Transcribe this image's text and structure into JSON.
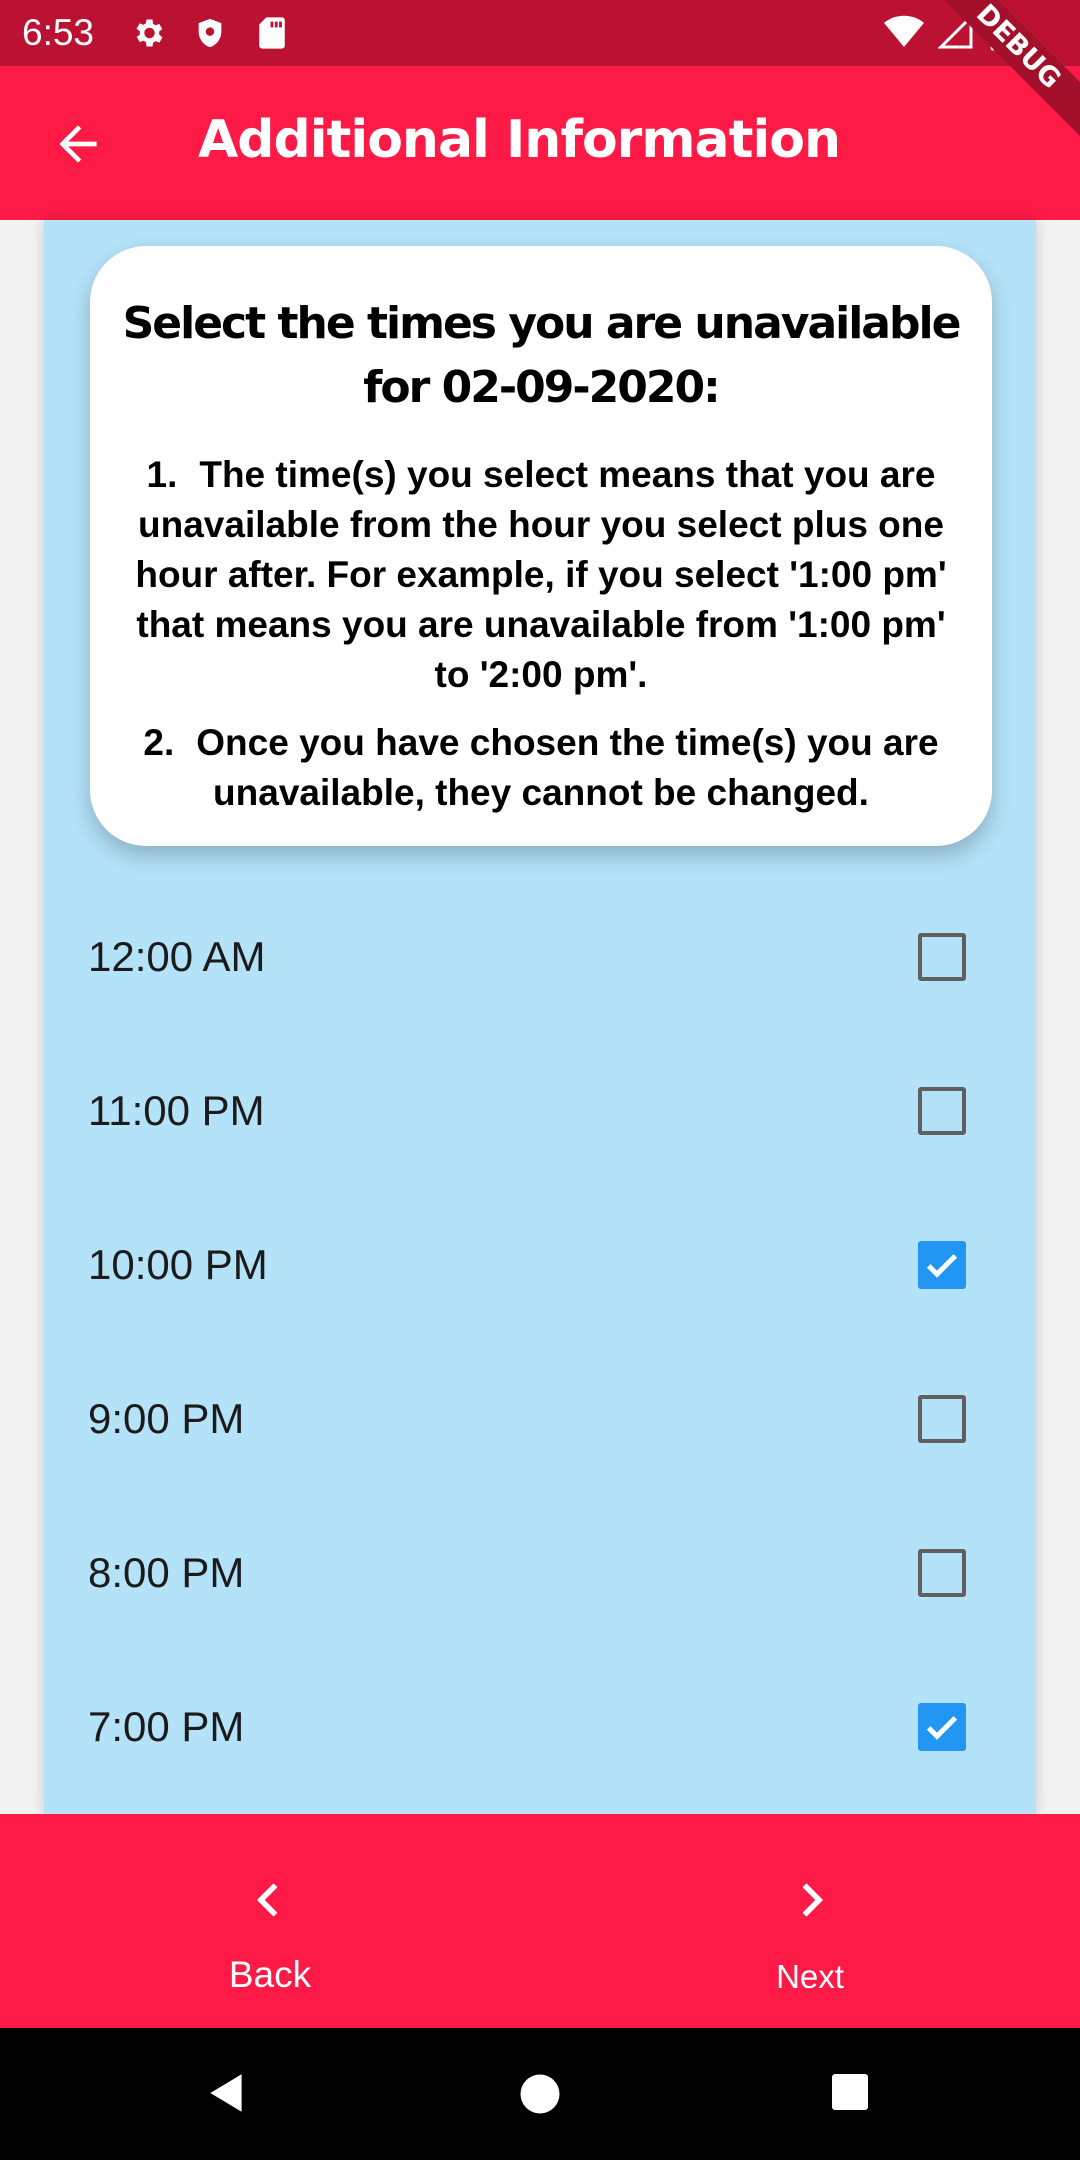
{
  "status_bar": {
    "time": "6:53",
    "left_icons": [
      "gear-icon",
      "shield-icon",
      "sd-card-icon"
    ],
    "right_icons": [
      "wifi-icon",
      "signal-icon",
      "battery-icon"
    ],
    "background": "#bb1234"
  },
  "debug_banner": "DEBUG",
  "app_bar": {
    "title": "Additional Information",
    "background": "#fe1a46"
  },
  "info_card": {
    "title": "Select the times you are unavailable for 02-09-2020:",
    "rules": [
      {
        "number": "1.",
        "text": "The time(s) you select means that you are unavailable from the hour you select plus one hour after. For example, if you select '1:00 pm' that means you are unavailable from '1:00 pm' to '2:00 pm'."
      },
      {
        "number": "2.",
        "text": "Once you have chosen the time(s) you are unavailable, they cannot be changed."
      }
    ]
  },
  "time_slots": [
    {
      "label": "12:00 AM",
      "checked": false
    },
    {
      "label": "11:00 PM",
      "checked": false
    },
    {
      "label": "10:00 PM",
      "checked": true
    },
    {
      "label": "9:00 PM",
      "checked": false
    },
    {
      "label": "8:00 PM",
      "checked": false
    },
    {
      "label": "7:00 PM",
      "checked": true
    }
  ],
  "bottom_nav": {
    "back_label": "Back",
    "next_label": "Next"
  },
  "colors": {
    "accent": "#fe1a46",
    "panel": "#b3e2f9",
    "checkbox_checked": "#2196f3"
  }
}
